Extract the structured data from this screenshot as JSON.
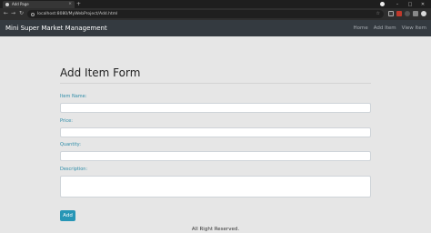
{
  "browser": {
    "tab_title": "Add Page",
    "new_tab_symbol": "+",
    "url": "localhost:8080/MyWebProject/Add.html",
    "back_symbol": "←",
    "forward_symbol": "→",
    "reload_symbol": "↻",
    "bookmark_symbol": "☆",
    "minimize_symbol": "–",
    "maximize_symbol": "□",
    "close_symbol": "✕",
    "tab_close_symbol": "×"
  },
  "navbar": {
    "brand": "Mini Super Market Management",
    "links": [
      "Home",
      "Add Item",
      "View Item"
    ]
  },
  "form": {
    "title": "Add Item Form",
    "fields": [
      {
        "label": "Item Name:",
        "value": ""
      },
      {
        "label": "Price:",
        "value": ""
      },
      {
        "label": "Quantity:",
        "value": ""
      },
      {
        "label": "Description:",
        "value": ""
      }
    ],
    "submit_label": "Add"
  },
  "footer": {
    "text": "All Right Reserved."
  },
  "colors": {
    "navbar_bg": "#343a40",
    "label": "#2e8ca8",
    "button": "#2796b6",
    "page_bg": "#e6e6e6"
  }
}
